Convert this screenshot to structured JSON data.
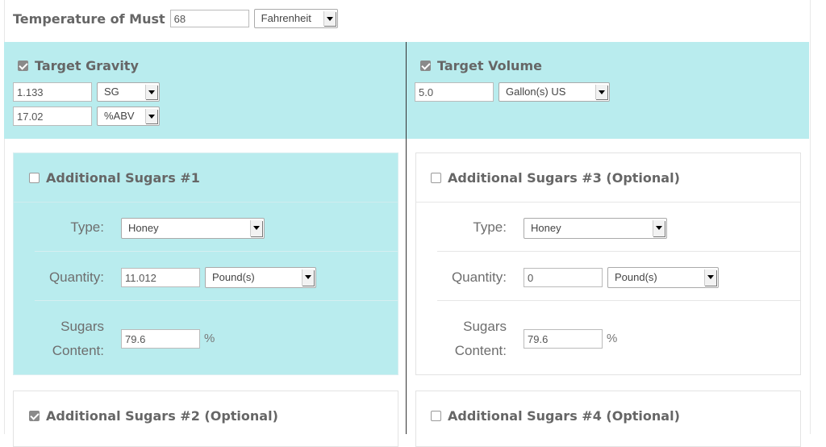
{
  "must": {
    "label": "Temperature of Must",
    "value": "68",
    "unit": "Fahrenheit"
  },
  "target_gravity": {
    "label": "Target Gravity",
    "checked": true,
    "gravity_value": "1.133",
    "gravity_unit": "SG",
    "abv_value": "17.02",
    "abv_unit": "%ABV"
  },
  "target_volume": {
    "label": "Target Volume",
    "checked": true,
    "value": "5.0",
    "unit": "Gallon(s) US"
  },
  "sugars1": {
    "title": "Additional Sugars #1",
    "checked": false,
    "type_label": "Type:",
    "type_value": "Honey",
    "qty_label": "Quantity:",
    "qty_value": "11.012",
    "qty_unit": "Pound(s)",
    "content_label_1": "Sugars",
    "content_label_2": "Content:",
    "content_value": "79.6",
    "pct": "%"
  },
  "sugars3": {
    "title": "Additional Sugars #3 (Optional)",
    "checked": false,
    "type_label": "Type:",
    "type_value": "Honey",
    "qty_label": "Quantity:",
    "qty_value": "0",
    "qty_unit": "Pound(s)",
    "content_label_1": "Sugars",
    "content_label_2": "Content:",
    "content_value": "79.6",
    "pct": "%"
  },
  "sugars2": {
    "title": "Additional Sugars #2 (Optional)",
    "checked": true
  },
  "sugars4": {
    "title": "Additional Sugars #4 (Optional)",
    "checked": false
  }
}
